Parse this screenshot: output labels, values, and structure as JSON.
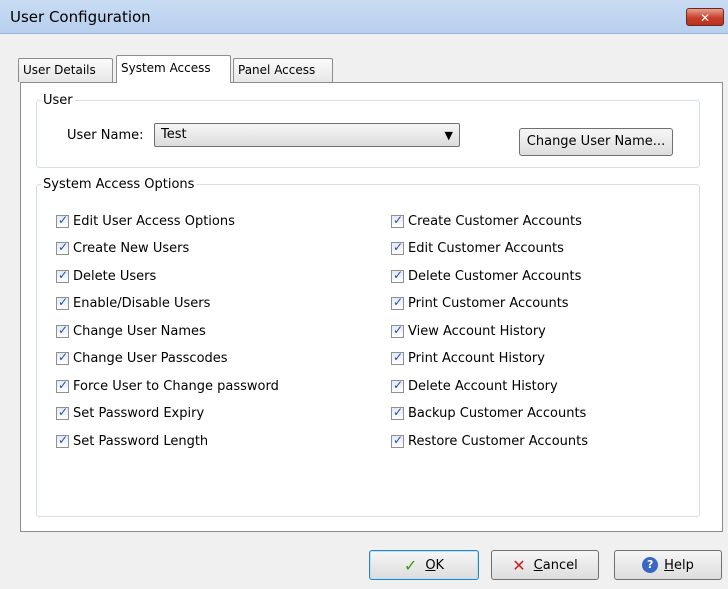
{
  "window": {
    "title": "User Configuration",
    "close_glyph": "✕"
  },
  "tabs": [
    {
      "label": "User Details"
    },
    {
      "label": "System Access"
    },
    {
      "label": "Panel Access"
    }
  ],
  "active_tab": "System Access",
  "user_group": {
    "legend": "User",
    "user_name_label": "User Name:",
    "user_name_value": "Test",
    "change_button": "Change User Name..."
  },
  "options_group": {
    "legend": "System Access Options",
    "left": [
      {
        "label": "Edit User Access Options",
        "checked": true
      },
      {
        "label": "Create New Users",
        "checked": true
      },
      {
        "label": "Delete Users",
        "checked": true
      },
      {
        "label": "Enable/Disable Users",
        "checked": true
      },
      {
        "label": "Change User Names",
        "checked": true
      },
      {
        "label": "Change User Passcodes",
        "checked": true
      },
      {
        "label": "Force User to Change password",
        "checked": true
      },
      {
        "label": "Set Password Expiry",
        "checked": true
      },
      {
        "label": "Set Password Length",
        "checked": true
      }
    ],
    "right": [
      {
        "label": "Create Customer Accounts",
        "checked": true
      },
      {
        "label": "Edit Customer Accounts",
        "checked": true
      },
      {
        "label": "Delete Customer Accounts",
        "checked": true
      },
      {
        "label": "Print Customer Accounts",
        "checked": true
      },
      {
        "label": "View Account History",
        "checked": true
      },
      {
        "label": "Print Account History",
        "checked": true
      },
      {
        "label": "Delete Account History",
        "checked": true
      },
      {
        "label": "Backup Customer Accounts",
        "checked": true
      },
      {
        "label": "Restore Customer Accounts",
        "checked": true
      }
    ]
  },
  "footer": {
    "ok": {
      "accel": "O",
      "rest": "K"
    },
    "cancel": {
      "accel": "C",
      "rest": "ancel"
    },
    "help": {
      "accel": "H",
      "rest": "elp"
    }
  },
  "icons": {
    "ok": "checkmark-icon",
    "cancel": "x-icon",
    "help": "help-icon"
  },
  "colors": {
    "titlebar": "#c9dcf3",
    "close": "#c8402b",
    "check": "#2a4f8e"
  }
}
